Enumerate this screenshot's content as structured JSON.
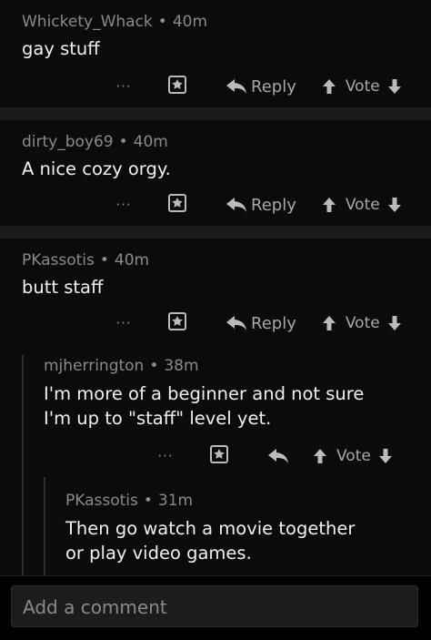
{
  "comments": [
    {
      "user": "Whickety_Whack",
      "time": "40m",
      "text": [
        "gay stuff"
      ]
    },
    {
      "user": "dirty_boy69",
      "time": "40m",
      "text": [
        "A nice cozy orgy."
      ]
    },
    {
      "user": "PKassotis",
      "time": "40m",
      "text": [
        "butt staff"
      ]
    },
    {
      "user": "mjherrington",
      "time": "38m",
      "text": [
        "I'm more of a beginner and not sure",
        "I'm up to \"staff\" level yet."
      ]
    },
    {
      "user": "PKassotis",
      "time": "31m",
      "text": [
        "Then go watch a movie together",
        "or play video games."
      ]
    }
  ],
  "actions": {
    "more": "···",
    "reply": "Reply",
    "vote": "Vote",
    "dot": "•"
  },
  "composer": {
    "placeholder": "Add a comment"
  },
  "colors": {
    "background": "#000000",
    "meta": "#8a8a8a",
    "text": "#f0f0f0"
  },
  "icons": [
    "more-icon",
    "award-icon",
    "reply-icon",
    "upvote-icon",
    "downvote-icon"
  ]
}
